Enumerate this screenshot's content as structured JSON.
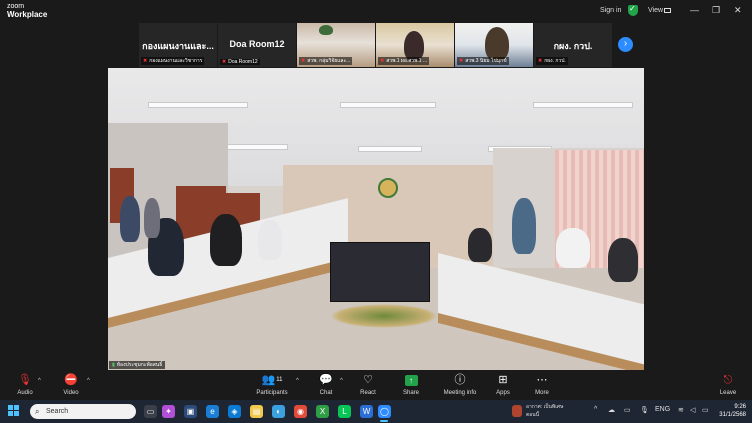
{
  "app": {
    "brand_line1": "zoom",
    "brand_line2": "Workplace",
    "signin": "Sign in",
    "view": "View"
  },
  "strip": {
    "tiles": [
      {
        "big": "กองแผนงานและ...",
        "small": "กองแผนงานและวิชาการ"
      },
      {
        "big": "Doa Room12",
        "small": "Doa Room12"
      },
      {
        "small": "สวพ. กลุ่มวิจัยและ..."
      },
      {
        "small": "สวพ.1 ผอ.สวพ.1 ..."
      },
      {
        "small": "สวพ.3 นิยม ไข่มุกข์"
      },
      {
        "big": "กผง. กวป.",
        "small": "กผง. กวป."
      }
    ]
  },
  "main": {
    "speaker_label": "ห้องประชุมกะพ้อสนธิ์"
  },
  "toolbar": {
    "audio": "Audio",
    "video": "Video",
    "participants": "Participants",
    "participant_count": "11",
    "chat": "Chat",
    "react": "React",
    "share": "Share",
    "meeting_info": "Meeting info",
    "apps": "Apps",
    "more": "More",
    "leave": "Leave"
  },
  "taskbar": {
    "search_placeholder": "Search",
    "weather_line1": "อากาศ: เป็นพิเศษ",
    "weather_line2": "ตอนนี้",
    "lang": "ENG",
    "time": "9:26",
    "date": "31/1/2568"
  }
}
